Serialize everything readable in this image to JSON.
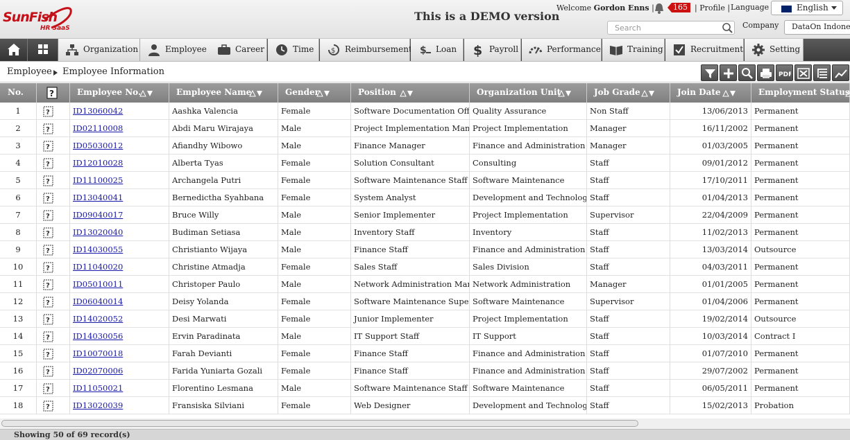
{
  "header": {
    "brand": "SunFish",
    "brand_sub": "HR SaaS",
    "demo_notice": "This is a DEMO version",
    "welcome_prefix": "Welcome",
    "user_name": "Gordon Enns",
    "notification_count": "165",
    "profile_link": "Profile",
    "language_label": "Language",
    "language_value": "English",
    "search_placeholder": "Search",
    "company_label": "Company",
    "company_value": "DataOn Indonesia"
  },
  "nav": {
    "items": [
      {
        "label": "Organization",
        "icon": "organization-icon"
      },
      {
        "label": "Employee",
        "icon": "employee-icon"
      },
      {
        "label": "Career",
        "icon": "briefcase-icon"
      },
      {
        "label": "Time",
        "icon": "clock-icon"
      },
      {
        "label": "Reimbursement",
        "icon": "reimbursement-icon"
      },
      {
        "label": "Loan",
        "icon": "loan-icon"
      },
      {
        "label": "Payroll",
        "icon": "dollar-icon"
      },
      {
        "label": "Performance",
        "icon": "gauge-icon"
      },
      {
        "label": "Training",
        "icon": "book-icon"
      },
      {
        "label": "Recruitment",
        "icon": "checkbox-icon"
      },
      {
        "label": "Setting",
        "icon": "gear-icon"
      }
    ]
  },
  "breadcrumb": {
    "root": "Employee",
    "current": "Employee Information"
  },
  "toolbar": [
    "filter-icon",
    "add-icon",
    "search-icon",
    "print-icon",
    "pdf-icon",
    "excel-icon",
    "columns-icon",
    "chart-icon"
  ],
  "table": {
    "columns": [
      "No.",
      "",
      "Employee No.",
      "Employee Name",
      "Gender",
      "Position",
      "Organization Unit",
      "Job Grade",
      "Join Date",
      "Employment Status"
    ],
    "rows": [
      [
        "1",
        "ID13060042",
        "Aashka Valencia",
        "Female",
        "Software Documentation Officer",
        "Quality Assurance",
        "Non Staff",
        "13/06/2013",
        "Permanent"
      ],
      [
        "2",
        "ID02110008",
        "Abdi Maru Wirajaya",
        "Male",
        "Project Implementation Manager",
        "Project Implementation",
        "Manager",
        "16/11/2002",
        "Permanent"
      ],
      [
        "3",
        "ID05030012",
        "Afiandhy Wibowo",
        "Male",
        "Finance Manager",
        "Finance and Administration",
        "Manager",
        "01/03/2005",
        "Permanent"
      ],
      [
        "4",
        "ID12010028",
        "Alberta Tyas",
        "Female",
        "Solution Consultant",
        "Consulting",
        "Staff",
        "09/01/2012",
        "Permanent"
      ],
      [
        "5",
        "ID11100025",
        "Archangela Putri",
        "Female",
        "Software Maintenance Staff",
        "Software Maintenance",
        "Staff",
        "17/10/2011",
        "Permanent"
      ],
      [
        "6",
        "ID13040041",
        "Bernedictha Syahbana",
        "Female",
        "System Analyst",
        "Development and Technology",
        "Staff",
        "01/04/2013",
        "Permanent"
      ],
      [
        "7",
        "ID09040017",
        "Bruce Willy",
        "Male",
        "Senior Implementer",
        "Project Implementation",
        "Supervisor",
        "22/04/2009",
        "Permanent"
      ],
      [
        "8",
        "ID13020040",
        "Budiman Setiasa",
        "Male",
        "Inventory Staff",
        "Inventory",
        "Staff",
        "11/02/2013",
        "Permanent"
      ],
      [
        "9",
        "ID14030055",
        "Christianto Wijaya",
        "Male",
        "Finance Staff",
        "Finance and Administration",
        "Staff",
        "13/03/2014",
        "Outsource"
      ],
      [
        "10",
        "ID11040020",
        "Christine Atmadja",
        "Female",
        "Sales Staff",
        "Sales Division",
        "Staff",
        "04/03/2011",
        "Permanent"
      ],
      [
        "11",
        "ID05010011",
        "Christoper Paulo",
        "Male",
        "Network Administration Manager",
        "Network Administration",
        "Manager",
        "01/01/2005",
        "Permanent"
      ],
      [
        "12",
        "ID06040014",
        "Deisy Yolanda",
        "Female",
        "Software Maintenance Supervisor",
        "Software Maintenance",
        "Supervisor",
        "01/04/2006",
        "Permanent"
      ],
      [
        "13",
        "ID14020052",
        "Desi Marwati",
        "Female",
        "Junior Implementer",
        "Project Implementation",
        "Staff",
        "19/02/2014",
        "Outsource"
      ],
      [
        "14",
        "ID14030056",
        "Ervin Paradinata",
        "Male",
        "IT Support Staff",
        "IT Support",
        "Staff",
        "10/03/2014",
        "Contract I"
      ],
      [
        "15",
        "ID10070018",
        "Farah Devianti",
        "Female",
        "Finance Staff",
        "Finance and Administration",
        "Staff",
        "01/07/2010",
        "Permanent"
      ],
      [
        "16",
        "ID02070006",
        "Farida Yuniarta Gozali",
        "Female",
        "Finance Staff",
        "Finance and Administration",
        "Staff",
        "29/07/2002",
        "Permanent"
      ],
      [
        "17",
        "ID11050021",
        "Florentino Lesmana",
        "Male",
        "Software Maintenance Staff",
        "Software Maintenance",
        "Staff",
        "06/05/2011",
        "Permanent"
      ],
      [
        "18",
        "ID13020039",
        "Fransiska Silviani",
        "Female",
        "Web Designer",
        "Development and Technology",
        "Staff",
        "15/02/2013",
        "Probation"
      ]
    ]
  },
  "footer": {
    "status": "Showing 50 of 69 record(s)"
  }
}
